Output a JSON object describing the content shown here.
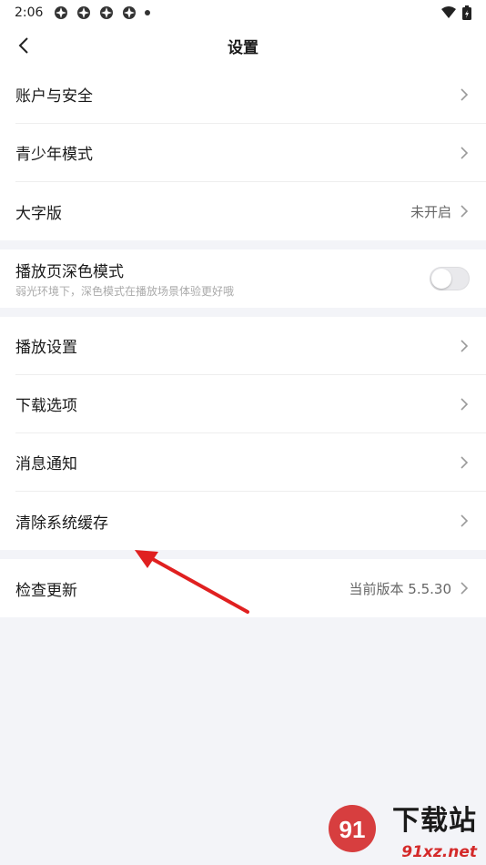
{
  "status_bar": {
    "time": "2:06",
    "notification_icons": [
      "app-notification-icon",
      "app-notification-icon",
      "app-notification-icon",
      "app-notification-icon"
    ],
    "right_icons": [
      "wifi-icon",
      "battery-icon"
    ]
  },
  "header": {
    "title": "设置",
    "back_icon": "chevron-left-icon"
  },
  "groups": [
    {
      "items": [
        {
          "label": "账户与安全"
        },
        {
          "label": "青少年模式"
        },
        {
          "label": "大字版",
          "value": "未开启"
        }
      ]
    },
    {
      "items": [
        {
          "label": "播放页深色模式",
          "subtitle": "弱光环境下，深色模式在播放场景体验更好哦",
          "toggle": false
        }
      ]
    },
    {
      "items": [
        {
          "label": "播放设置"
        },
        {
          "label": "下载选项"
        },
        {
          "label": "消息通知"
        },
        {
          "label": "清除系统缓存"
        }
      ]
    },
    {
      "items": [
        {
          "label": "检查更新",
          "value": "当前版本 5.5.30"
        }
      ]
    }
  ],
  "annotation": {
    "arrow_color": "#e02020"
  },
  "watermark": {
    "text_big": "下载站",
    "text_small": "91xz.net",
    "logo_text": "91"
  },
  "colors": {
    "background": "#f3f4f8",
    "surface": "#ffffff",
    "secondary_text": "#666666",
    "arrow": "#e02020"
  }
}
